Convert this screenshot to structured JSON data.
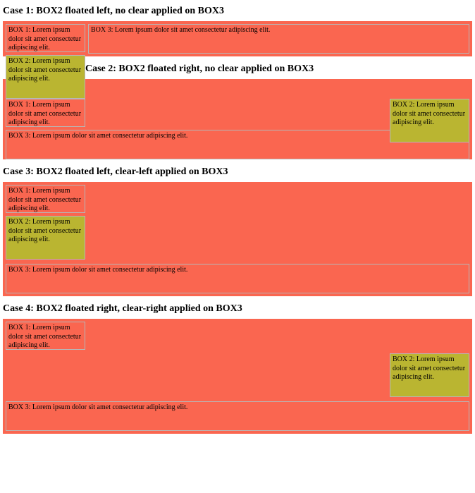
{
  "cases": {
    "c1": {
      "title": "Case 1: BOX2 floated left, no clear applied on BOX3",
      "box1": "BOX 1: Lorem ipsum dolor sit amet consectetur adipiscing elit.",
      "box2": "BOX 2: Lorem ipsum dolor sit amet consectetur adipiscing elit.",
      "box3": "BOX 3: Lorem ipsum dolor sit amet consectetur adipiscing elit."
    },
    "c2": {
      "title": "Case 2: BOX2 floated right, no clear applied on BOX3",
      "box1": "BOX 1: Lorem ipsum dolor sit amet consectetur adipiscing elit.",
      "box2": "BOX 2: Lorem ipsum dolor sit amet consectetur adipiscing elit.",
      "box3": "BOX 3: Lorem ipsum dolor sit amet consectetur adipiscing elit."
    },
    "c3": {
      "title": "Case 3: BOX2 floated left, clear-left applied on BOX3",
      "box1": "BOX 1: Lorem ipsum dolor sit amet consectetur adipiscing elit.",
      "box2": "BOX 2: Lorem ipsum dolor sit amet consectetur adipiscing elit.",
      "box3": "BOX 3: Lorem ipsum dolor sit amet consectetur adipiscing elit."
    },
    "c4": {
      "title": "Case 4: BOX2 floated right, clear-right applied on BOX3",
      "box1": "BOX 1: Lorem ipsum dolor sit amet consectetur adipiscing elit.",
      "box2": "BOX 2: Lorem ipsum dolor sit amet consectetur adipiscing elit.",
      "box3": "BOX 3: Lorem ipsum dolor sit amet consectetur adipiscing elit."
    }
  },
  "colors": {
    "container_bg": "#fa6650",
    "box2_bg": "#bab531",
    "box_border": "#b7b7b7"
  }
}
